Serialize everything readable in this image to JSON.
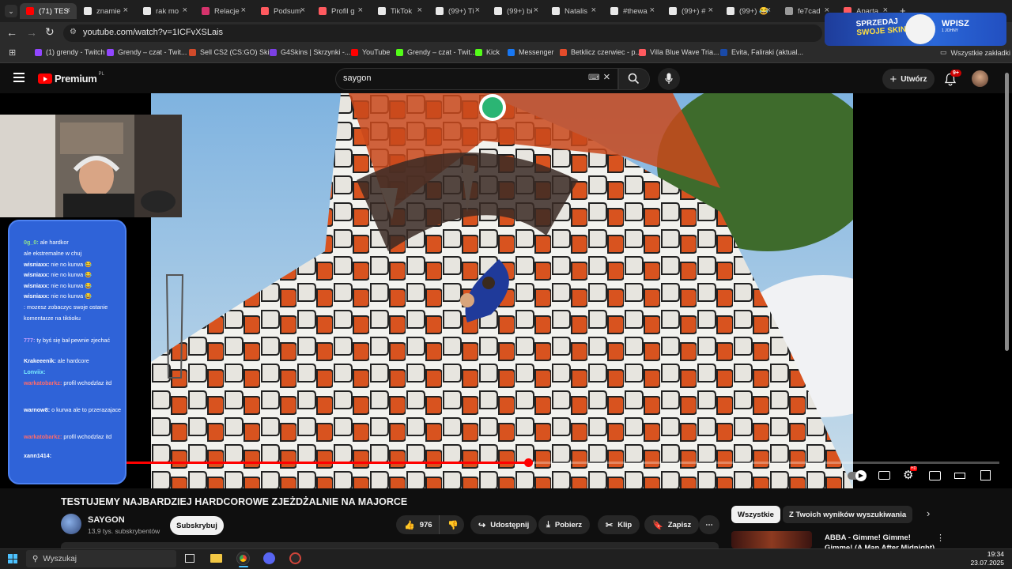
{
  "browser": {
    "tabs": [
      {
        "title": "(71) TES",
        "icon": "youtube-favicon",
        "color": "#ff0000",
        "active": true
      },
      {
        "title": "znamie",
        "icon": "google-favicon",
        "color": "#e8e8e8"
      },
      {
        "title": "rak mo",
        "icon": "google-favicon",
        "color": "#e8e8e8"
      },
      {
        "title": "Relacje",
        "icon": "instagram-favicon",
        "color": "#d6336c"
      },
      {
        "title": "Podsum",
        "icon": "airbnb-favicon",
        "color": "#ff5a5f"
      },
      {
        "title": "Profil g",
        "icon": "airbnb-favicon",
        "color": "#ff5a5f"
      },
      {
        "title": "TikTok",
        "icon": "tiktok-favicon",
        "color": "#e8e8e8"
      },
      {
        "title": "(99+) Ti",
        "icon": "tiktok-favicon",
        "color": "#e8e8e8"
      },
      {
        "title": "(99+) bi",
        "icon": "tiktok-favicon",
        "color": "#e8e8e8"
      },
      {
        "title": "Natalis",
        "icon": "tiktok-favicon",
        "color": "#e8e8e8"
      },
      {
        "title": "#thewa",
        "icon": "tiktok-favicon",
        "color": "#e8e8e8"
      },
      {
        "title": "(99+) #",
        "icon": "tiktok-favicon",
        "color": "#e8e8e8"
      },
      {
        "title": "(99+) 😂",
        "icon": "tiktok-favicon",
        "color": "#e8e8e8"
      },
      {
        "title": "fe7cad",
        "icon": "globe-favicon",
        "color": "#9a9a9a"
      },
      {
        "title": "Aparta",
        "icon": "airbnb-favicon",
        "color": "#ff5a5f"
      }
    ],
    "url": "youtube.com/watch?v=1ICFvXSLais",
    "bookmarks": [
      {
        "label": "(1) grendy - Twitch",
        "color": "#9146ff"
      },
      {
        "label": "Grendy – czat - Twit...",
        "color": "#9146ff"
      },
      {
        "label": "Sell CS2 (CS:GO) Ski...",
        "color": "#d04a2a"
      },
      {
        "label": "G4Skins | Skrzynki -...",
        "color": "#7b3fe4"
      },
      {
        "label": "YouTube",
        "color": "#ff0000"
      },
      {
        "label": "Grendy – czat - Twit...",
        "color": "#53fc18"
      },
      {
        "label": "Kick",
        "color": "#53fc18"
      },
      {
        "label": "Messenger",
        "color": "#1877f2"
      },
      {
        "label": "Betklicz czerwiec - p...",
        "color": "#e44c2b"
      },
      {
        "label": "Villa Blue Wave Tria...",
        "color": "#ff5a5f"
      },
      {
        "label": "Evita, Faliraki (aktual...",
        "color": "#1a4aa8"
      }
    ],
    "bookmarks_folder": "Wszystkie zakładki"
  },
  "ad": {
    "line1": "SPRZEDAJ",
    "line2": "SWOJE SKINY",
    "cta": "WPISZ",
    "cta_sub": "1 JOHNY"
  },
  "youtube": {
    "logo": "Premium",
    "logo_region": "PL",
    "search_value": "saygon",
    "create_label": "Utwórz",
    "notif_count": "9+",
    "video_title": "TESTUJEMY NAJBARDZIEJ HARDCOROWE ZJEŻDŻALNIE NA MAJORCE",
    "channel_name": "SAYGON",
    "channel_subs": "13,9 tys. subskrybentów",
    "subscribe_label": "Subskrybuj",
    "likes": "976",
    "share_label": "Udostępnij",
    "download_label": "Pobierz",
    "clip_label": "Klip",
    "save_label": "Zapisz",
    "chips": [
      "Wszystkie",
      "Z Twoich wyników wyszukiwania"
    ],
    "recommended_title": "ABBA - Gimme! Gimme! Gimme! (A Man After Midnight)",
    "progress": 0.46
  },
  "chat": [
    {
      "user": "0g_0:",
      "msg": "ale hardkor",
      "color": "#8fe28f"
    },
    {
      "user": "",
      "msg": "ale ekstremalne w chuj",
      "color": "#ff7ad9"
    },
    {
      "user": "wisniaxx:",
      "msg": "nie no kurwa 😂",
      "color": "#ffffff"
    },
    {
      "user": "wisniaxx:",
      "msg": "nie no kurwa 😂",
      "color": "#ffffff"
    },
    {
      "user": "wisniaxx:",
      "msg": "nie no kurwa 😂",
      "color": "#ffffff"
    },
    {
      "user": "wisniaxx:",
      "msg": "nie no kurwa 😂",
      "color": "#ffffff"
    },
    {
      "user": "",
      "msg": ": mozesz zobaczyc swoje ostanie komentarze na tiktioku",
      "color": "#ffffff"
    },
    {
      "user": "777:",
      "msg": "ty byś się bał pewnie zjechać",
      "color": "#c8a0ff"
    },
    {
      "user": "Krakeeenik:",
      "msg": "ale hardcore",
      "color": "#ffffff"
    },
    {
      "user": "Lonviix:",
      "msg": "",
      "color": "#7cf1ff"
    },
    {
      "user": "warkatobarkz:",
      "msg": "profil wchodzlaz itd",
      "color": "#ff6b6b"
    },
    {
      "user": "warnow8:",
      "msg": "o kurwa ale to przerazajace",
      "color": "#ffffff"
    },
    {
      "user": "warkatobarkz:",
      "msg": "profil wchodzlaz itd",
      "color": "#ff6b6b"
    },
    {
      "user": "xann1414:",
      "msg": "",
      "color": "#ffffff"
    }
  ],
  "taskbar": {
    "search_placeholder": "Wyszukaj",
    "time": "19:34",
    "date": "23.07.2025"
  }
}
